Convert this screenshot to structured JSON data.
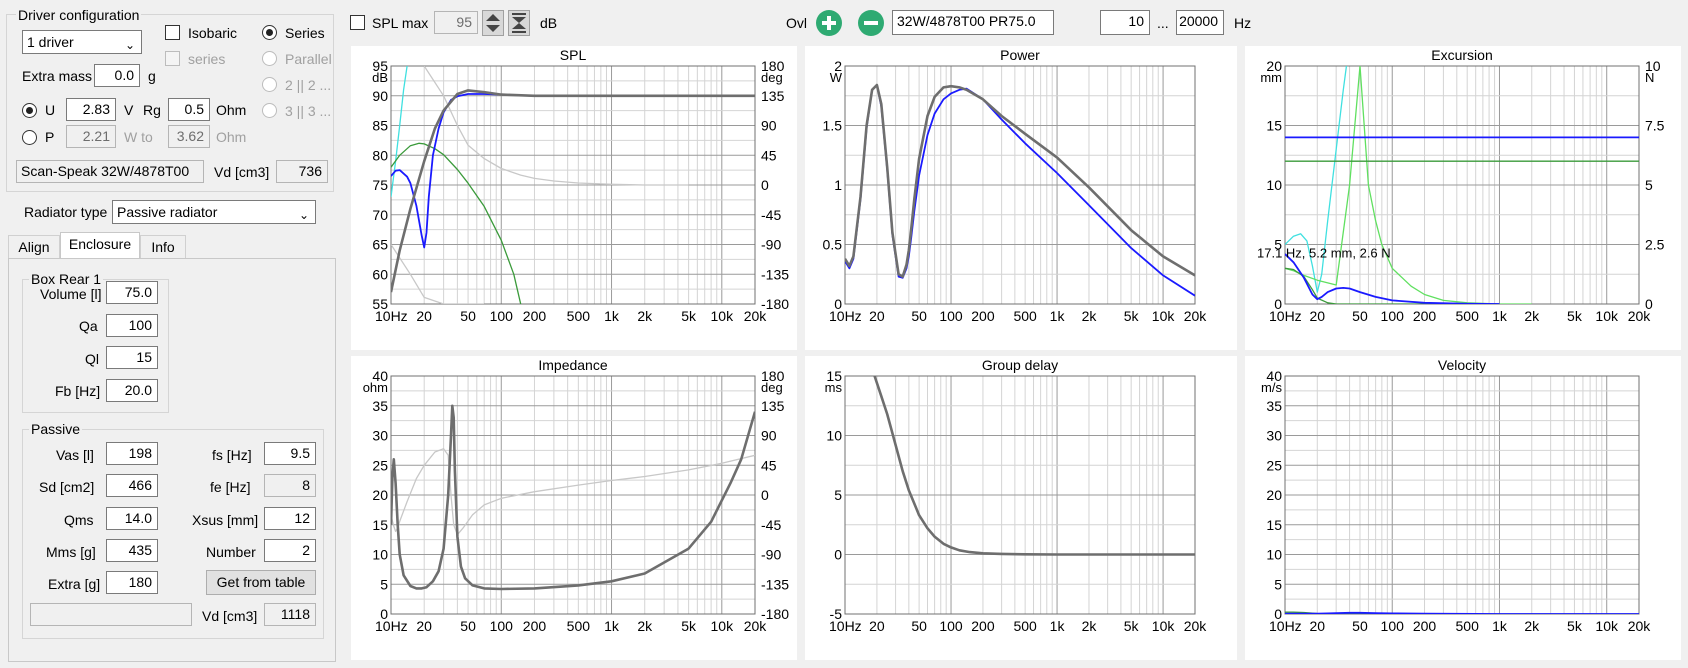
{
  "driver_config": {
    "title": "Driver configuration",
    "drivers_select": "1 driver",
    "isobaric_label": "Isobaric",
    "series_sub_label": "series",
    "series_label": "Series",
    "parallel_label": "Parallel",
    "config2_label": "2 || 2 ...",
    "config3_label": "3 || 3 ...",
    "extra_mass_label": "Extra mass",
    "extra_mass_value": "0.0",
    "extra_mass_unit": "g",
    "u_label": "U",
    "u_value": "2.83",
    "u_unit": "V",
    "rg_label": "Rg",
    "rg_value": "0.5",
    "rg_unit": "Ohm",
    "p_label": "P",
    "p_value": "2.21",
    "w_to_label": "W to",
    "w_to_value": "3.62",
    "w_to_unit": "Ohm",
    "driver_name": "Scan-Speak 32W/4878T00",
    "vd_label": "Vd [cm3]",
    "vd_value": "736"
  },
  "radiator": {
    "label": "Radiator type",
    "value": "Passive radiator"
  },
  "tabs": [
    {
      "label": "Align"
    },
    {
      "label": "Enclosure"
    },
    {
      "label": "Info"
    }
  ],
  "box": {
    "title": "Box Rear 1",
    "volume_label": "Volume [l]",
    "volume_value": "75.0",
    "qa_label": "Qa",
    "qa_value": "100",
    "ql_label": "Ql",
    "ql_value": "15",
    "fb_label": "Fb [Hz]",
    "fb_value": "20.0"
  },
  "passive": {
    "title": "Passive",
    "vas_label": "Vas [l]",
    "vas_value": "198",
    "fs_label": "fs [Hz]",
    "fs_value": "9.5",
    "sd_label": "Sd [cm2]",
    "sd_value": "466",
    "fe_label": "fe [Hz]",
    "fe_value": "8",
    "qms_label": "Qms",
    "qms_value": "14.0",
    "xsus_label": "Xsus [mm]",
    "xsus_value": "12",
    "mms_label": "Mms [g]",
    "mms_value": "435",
    "number_label": "Number",
    "number_value": "2",
    "extra_label": "Extra [g]",
    "extra_value": "180",
    "get_button": "Get from table",
    "name_value": "",
    "vd_label": "Vd [cm3]",
    "vd_value": "1118"
  },
  "toolbar": {
    "spl_max_label": "SPL max",
    "spl_max_value": "95",
    "db_label": "dB",
    "ovl_label": "Ovl",
    "overlay_name": "32W/4878T00 PR75.0",
    "freq_min": "10",
    "freq_sep": "...",
    "freq_max": "20000",
    "hz_label": "Hz"
  },
  "colors": {
    "gray_curve": "#6e6e6e",
    "blue_curve": "#1a1aff",
    "green_curve": "#3a9a3a",
    "cyan_curve": "#40e0e0",
    "lightgreen_curve": "#60e060",
    "lightgray_curve": "#c8c8c8",
    "button_green": "#2eaa72"
  },
  "x_ticks": [
    "10Hz",
    "20",
    "50",
    "100",
    "200",
    "500",
    "1k",
    "2k",
    "5k",
    "10k",
    "20k"
  ],
  "chart_data": [
    {
      "type": "line",
      "title": "SPL",
      "ylabel": "dB",
      "y2label": "deg",
      "xscale": "log",
      "xlim": [
        10,
        20000
      ],
      "ylim": [
        55,
        95
      ],
      "yticks": [
        "95",
        "90",
        "85",
        "80",
        "75",
        "70",
        "65",
        "60",
        "55"
      ],
      "y2lim": [
        -180,
        180
      ],
      "y2ticks": [
        "180",
        "135",
        "90",
        "45",
        "0",
        "-45",
        "-90",
        "-135",
        "-180"
      ],
      "grid": true,
      "series": [
        {
          "color": "#6e6e6e",
          "axis": "left",
          "x": [
            10,
            12,
            15,
            20,
            25,
            30,
            40,
            50,
            70,
            100,
            200,
            500,
            1000,
            5000,
            20000
          ],
          "y": [
            57,
            64,
            71,
            79,
            84.5,
            87.5,
            90.3,
            90.9,
            90.6,
            90.2,
            90.0,
            90.0,
            90.0,
            90.0,
            90.0
          ]
        },
        {
          "color": "#1a1aff",
          "axis": "left",
          "x": [
            10,
            11,
            12,
            14,
            15,
            17,
            19,
            20,
            21,
            22,
            24,
            27,
            30,
            35,
            40,
            50,
            70,
            100,
            200,
            1000,
            20000
          ],
          "y": [
            76.5,
            77.4,
            77.5,
            76.4,
            75.3,
            71.5,
            66.5,
            64.5,
            67,
            73,
            80,
            84.5,
            87.2,
            89.3,
            89.9,
            90.3,
            90.3,
            90.2,
            90.0,
            90.0,
            90.0
          ]
        },
        {
          "color": "#3a9a3a",
          "axis": "left",
          "x": [
            10,
            12,
            15,
            18,
            20,
            25,
            30,
            40,
            50,
            70,
            100,
            130,
            150
          ],
          "y": [
            78,
            80,
            81.6,
            82.0,
            81.9,
            81.1,
            80.1,
            77.6,
            75.3,
            71.4,
            65.7,
            60,
            55
          ]
        },
        {
          "color": "#40e0e0",
          "axis": "left",
          "x": [
            10,
            11,
            12,
            13,
            14
          ],
          "y": [
            73,
            79,
            85,
            91,
            95
          ]
        },
        {
          "color": "#c8c8c8",
          "axis": "right",
          "x": [
            20,
            30,
            40,
            50,
            70,
            100,
            150,
            200,
            300,
            500,
            1000,
            2000,
            5000
          ],
          "y": [
            180,
            135,
            90,
            60,
            40,
            25,
            15,
            10,
            6,
            3,
            1,
            0,
            0
          ]
        },
        {
          "color": "#c8c8c8",
          "axis": "right",
          "x": [
            10,
            15,
            20,
            30,
            50,
            70
          ],
          "y": [
            -90,
            -135,
            -170,
            -180,
            -180,
            -180
          ]
        }
      ]
    },
    {
      "type": "line",
      "title": "Power",
      "ylabel": "W",
      "xscale": "log",
      "xlim": [
        10,
        20000
      ],
      "ylim": [
        0,
        2
      ],
      "yticks": [
        "2",
        "1.5",
        "1",
        "0.5",
        "0"
      ],
      "grid": true,
      "series": [
        {
          "color": "#6e6e6e",
          "x": [
            10,
            11,
            12,
            14,
            16,
            18,
            20,
            22,
            25,
            28,
            32,
            35,
            38,
            40,
            42,
            45,
            50,
            60,
            70,
            85,
            100,
            120,
            140,
            200,
            300,
            500,
            1000,
            2000,
            5000,
            10000,
            20000
          ],
          "y": [
            0.38,
            0.32,
            0.4,
            0.9,
            1.5,
            1.8,
            1.84,
            1.68,
            1.15,
            0.6,
            0.25,
            0.23,
            0.33,
            0.45,
            0.62,
            0.88,
            1.22,
            1.58,
            1.74,
            1.82,
            1.83,
            1.82,
            1.8,
            1.72,
            1.58,
            1.43,
            1.23,
            0.98,
            0.62,
            0.4,
            0.24
          ]
        },
        {
          "color": "#1a1aff",
          "x": [
            10,
            11,
            12,
            14,
            16,
            18,
            20,
            22,
            25,
            28,
            32,
            35,
            38,
            40,
            42,
            45,
            50,
            60,
            70,
            85,
            100,
            120,
            140,
            200,
            300,
            500,
            1000,
            2000,
            5000,
            10000,
            20000
          ],
          "y": [
            0.36,
            0.3,
            0.38,
            0.88,
            1.48,
            1.8,
            1.84,
            1.66,
            1.13,
            0.58,
            0.23,
            0.22,
            0.3,
            0.4,
            0.55,
            0.78,
            1.08,
            1.42,
            1.6,
            1.72,
            1.77,
            1.8,
            1.81,
            1.72,
            1.55,
            1.35,
            1.1,
            0.83,
            0.47,
            0.24,
            0.07
          ]
        }
      ]
    },
    {
      "type": "line",
      "title": "Excursion",
      "ylabel": "mm",
      "y2label": "N",
      "xscale": "log",
      "xlim": [
        10,
        20000
      ],
      "ylim": [
        0,
        20
      ],
      "yticks": [
        "20",
        "15",
        "10",
        "5",
        "0"
      ],
      "y2lim": [
        0,
        10
      ],
      "y2ticks": [
        "10",
        "7.5",
        "5",
        "2.5",
        "0"
      ],
      "grid": true,
      "annotation": "17.1 Hz, 5.2 mm, 2.6 N",
      "series": [
        {
          "color": "#1a1aff",
          "x": [
            10,
            20000
          ],
          "y": [
            14,
            14
          ]
        },
        {
          "color": "#3a9a3a",
          "x": [
            10,
            20000
          ],
          "y": [
            12,
            12
          ]
        },
        {
          "color": "#40e0e0",
          "x": [
            10,
            12,
            14,
            16,
            18,
            20,
            22,
            25,
            30,
            35,
            40,
            45
          ],
          "y": [
            5.0,
            5.7,
            5.9,
            5.3,
            3.2,
            1.0,
            2.5,
            7.0,
            13,
            18,
            22,
            25
          ]
        },
        {
          "color": "#60e060",
          "x": [
            10,
            12,
            15,
            20,
            30,
            40,
            50,
            60,
            70,
            80,
            100,
            150,
            200,
            300,
            500,
            1000,
            2000
          ],
          "y": [
            3,
            2.8,
            2.4,
            2,
            1.6,
            10,
            20,
            10,
            7,
            5,
            3,
            1.5,
            0.8,
            0.3,
            0.1,
            0,
            0
          ]
        },
        {
          "color": "#1a1aff",
          "x": [
            10,
            12,
            15,
            18,
            20,
            22,
            25,
            30,
            35,
            40,
            50,
            70,
            100,
            200,
            500,
            1000
          ],
          "y": [
            4.2,
            3.5,
            2.2,
            0.8,
            0.4,
            0.6,
            1.0,
            1.3,
            1.35,
            1.3,
            1.0,
            0.6,
            0.3,
            0.1,
            0.02,
            0
          ]
        },
        {
          "color": "#3a9a3a",
          "x": [
            10,
            12,
            15,
            18,
            20,
            25,
            30,
            50,
            100,
            1000
          ],
          "y": [
            3.0,
            2.9,
            2.3,
            1.2,
            0.5,
            0.1,
            0.0,
            0.0,
            0.0,
            0.0
          ]
        }
      ]
    },
    {
      "type": "line",
      "title": "Impedance",
      "ylabel": "ohm",
      "y2label": "deg",
      "xscale": "log",
      "xlim": [
        10,
        20000
      ],
      "ylim": [
        0,
        40
      ],
      "yticks": [
        "40",
        "35",
        "30",
        "25",
        "20",
        "15",
        "10",
        "5",
        "0"
      ],
      "y2lim": [
        -180,
        180
      ],
      "y2ticks": [
        "180",
        "135",
        "90",
        "45",
        "0",
        "-45",
        "-90",
        "-135",
        "-180"
      ],
      "grid": true,
      "series": [
        {
          "color": "#6e6e6e",
          "axis": "left",
          "x": [
            10,
            10.3,
            10.6,
            11,
            11.5,
            12,
            13,
            15,
            17,
            19,
            21,
            24,
            27,
            30,
            33,
            35,
            36,
            37,
            38,
            40,
            43,
            47,
            55,
            70,
            100,
            200,
            500,
            1000,
            2000,
            5000,
            8000,
            12000,
            15000,
            20000
          ],
          "y": [
            15,
            23,
            26,
            22,
            15,
            10,
            6.5,
            4.7,
            4.3,
            4.3,
            4.5,
            5.5,
            7.2,
            11,
            20,
            30,
            35,
            33,
            24,
            13,
            8,
            6,
            4.8,
            4.3,
            4.2,
            4.3,
            4.8,
            5.5,
            6.8,
            11,
            15.5,
            22,
            26,
            34
          ]
        },
        {
          "color": "#c8c8c8",
          "axis": "right",
          "x": [
            10,
            10.5,
            11,
            11.5,
            12,
            14,
            17,
            20,
            25,
            30,
            33,
            35,
            37,
            40,
            45,
            55,
            70,
            100,
            200,
            500,
            1000,
            2000,
            5000,
            10000,
            20000
          ],
          "y": [
            -30,
            -45,
            -55,
            -50,
            -40,
            -10,
            25,
            45,
            65,
            70,
            60,
            0,
            -45,
            -60,
            -50,
            -30,
            -15,
            -5,
            5,
            15,
            22,
            28,
            38,
            48,
            60
          ]
        }
      ]
    },
    {
      "type": "line",
      "title": "Group delay",
      "ylabel": "ms",
      "xscale": "log",
      "xlim": [
        10,
        20000
      ],
      "ylim": [
        -5,
        15
      ],
      "yticks": [
        "15",
        "10",
        "5",
        "0",
        "-5"
      ],
      "grid": true,
      "series": [
        {
          "color": "#6e6e6e",
          "x": [
            19,
            22,
            25,
            30,
            35,
            40,
            50,
            60,
            70,
            85,
            100,
            120,
            150,
            200,
            300,
            500,
            1000,
            5000,
            20000
          ],
          "y": [
            15,
            13.3,
            11.8,
            9.2,
            7.0,
            5.4,
            3.3,
            2.2,
            1.5,
            0.9,
            0.6,
            0.35,
            0.2,
            0.1,
            0.05,
            0.02,
            0,
            0,
            0
          ]
        }
      ]
    },
    {
      "type": "line",
      "title": "Velocity",
      "ylabel": "m/s",
      "xscale": "log",
      "xlim": [
        10,
        20000
      ],
      "ylim": [
        0,
        40
      ],
      "yticks": [
        "40",
        "35",
        "30",
        "25",
        "20",
        "15",
        "10",
        "5",
        "0"
      ],
      "grid": true,
      "series": [
        {
          "color": "#3a9a3a",
          "x": [
            10,
            12,
            15,
            18,
            20,
            25,
            30,
            50,
            100,
            1000,
            20000
          ],
          "y": [
            0.3,
            0.3,
            0.25,
            0.15,
            0.08,
            0.02,
            0,
            0,
            0,
            0,
            0
          ]
        },
        {
          "color": "#1a1aff",
          "x": [
            10,
            20,
            25,
            30,
            40,
            50,
            70,
            100,
            200,
            1000,
            20000
          ],
          "y": [
            0.05,
            0.05,
            0.1,
            0.15,
            0.2,
            0.2,
            0.15,
            0.1,
            0.05,
            0,
            0
          ]
        }
      ]
    }
  ]
}
